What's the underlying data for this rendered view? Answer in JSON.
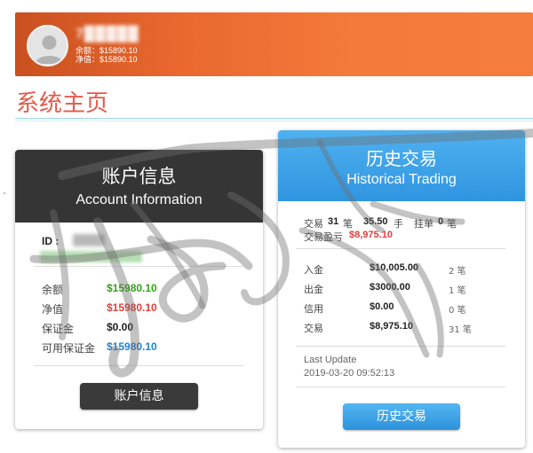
{
  "header": {
    "username": "7█████",
    "balance_line": "余额：$15890.10",
    "equity_line": "净值：$15890.10",
    "accent_color": "#f47c3c"
  },
  "page": {
    "title": "系统主页",
    "title_color": "#e35a4a"
  },
  "account_card": {
    "title_cn": "账户信息",
    "title_en": "Account Information",
    "id_label": "ID :",
    "rows": [
      {
        "label": "余额",
        "value": "$15980.10",
        "color": "#35a21a"
      },
      {
        "label": "净值",
        "value": "$15980.10",
        "color": "#e33e3e"
      },
      {
        "label": "保证金",
        "value": "$0.00",
        "color": "#222222"
      },
      {
        "label": "可用保证金",
        "value": "$15980.10",
        "color": "#1e82d2"
      }
    ],
    "button_label": "账户信息"
  },
  "history_card": {
    "title_cn": "历史交易",
    "title_en": "Historical Trading",
    "summary": {
      "trades_label": "交易",
      "trades_count": "31",
      "trades_unit": "笔",
      "lots": "35.50",
      "lots_unit": "手",
      "pending_label": "挂单",
      "pending_count": "0",
      "pending_unit": "笔",
      "pnl_label": "交易盈亏",
      "pnl_value": "$8,975.10"
    },
    "rows": [
      {
        "label": "入金",
        "amount": "$10,005.00",
        "count": "2 笔"
      },
      {
        "label": "出金",
        "amount": "$3000.00",
        "count": "1 笔"
      },
      {
        "label": "信用",
        "amount": "$0.00",
        "count": "0 笔"
      },
      {
        "label": "交易",
        "amount": "$8,975.10",
        "count": "31 笔"
      }
    ],
    "last_update_label": "Last Update",
    "last_update_value": "2019-03-20 09:52:13",
    "button_label": "历史交易",
    "accent_color": "#2f95e0"
  }
}
